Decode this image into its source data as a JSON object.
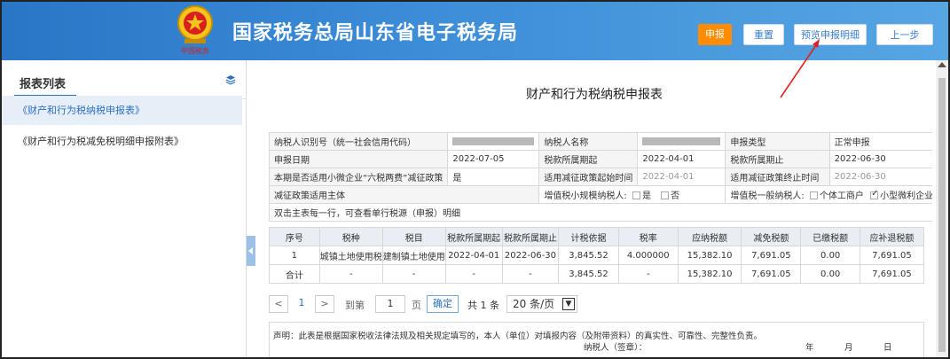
{
  "header": {
    "title": "国家税务总局山东省电子税务局",
    "emblem_text": "中国税务",
    "buttons": {
      "declare": "申报",
      "reset": "重置",
      "preview": "预览申报明细",
      "prev": "上一步"
    }
  },
  "sidebar": {
    "title": "报表列表",
    "items": [
      {
        "label": "《财产和行为税纳税申报表》",
        "active": true
      },
      {
        "label": "《财产和行为税减免税明细申报附表》",
        "active": false
      }
    ]
  },
  "doc": {
    "title": "财产和行为税纳税申报表",
    "info": {
      "taxpayer_id_label": "纳税人识别号（统一社会信用代码）",
      "taxpayer_name_label": "纳税人名称",
      "declare_type_label": "申报类型",
      "declare_type_value": "正常申报",
      "declare_date_label": "申报日期",
      "declare_date_value": "2022-07-05",
      "period_start_label": "税款所属期起",
      "period_start_value": "2022-04-01",
      "period_end_label": "税款所属期止",
      "period_end_value": "2022-06-30",
      "small_enterprise_label": "本期是否适用小微企业“六税两费”减征政策",
      "small_enterprise_value": "是",
      "policy_start_label": "适用减征政策起始时间",
      "policy_start_value": "2022-04-01",
      "policy_end_label": "适用减征政策终止时间",
      "policy_end_value": "2022-06-30",
      "policy_subject_label": "减征政策适用主体",
      "vat_small_label": "增值税小规模纳税人:",
      "opt_yes": "是",
      "opt_no": "否",
      "vat_general_label": "增值税一般纳税人:",
      "opt_individual": "个体工商户",
      "opt_micro": "小型微利企业",
      "hint": "双击主表每一行，可查看单行税源（申报）明细"
    },
    "columns": [
      "序号",
      "税种",
      "税目",
      "税款所属期起",
      "税款所属期止",
      "计税依据",
      "税率",
      "应纳税额",
      "减免税额",
      "已缴税额",
      "应补退税额"
    ],
    "rows": [
      [
        "1",
        "城镇土地使用税",
        "建制镇土地使用",
        "2022-04-01",
        "2022-06-30",
        "3,845.52",
        "4.000000",
        "15,382.10",
        "7,691.05",
        "0.00",
        "7,691.05"
      ],
      [
        "合计",
        "-",
        "-",
        "-",
        "-",
        "3,845.52",
        "-",
        "15,382.10",
        "7,691.05",
        "0.00",
        "7,691.05"
      ]
    ],
    "pager": {
      "prev": "<",
      "page": "1",
      "next": ">",
      "goto": "到第",
      "page_input": "1",
      "page_unit": "页",
      "confirm": "确定",
      "total": "共 1 条",
      "page_size": "20 条/页"
    },
    "declaration": "声明：此表是根据国家税收法律法规及相关规定填写的，本人（单位）对填报内容（及附带资料）的真实性、可靠性、完整性负责。",
    "signature": "纳税人（签章）：",
    "year": "年",
    "month": "月",
    "day": "日"
  }
}
